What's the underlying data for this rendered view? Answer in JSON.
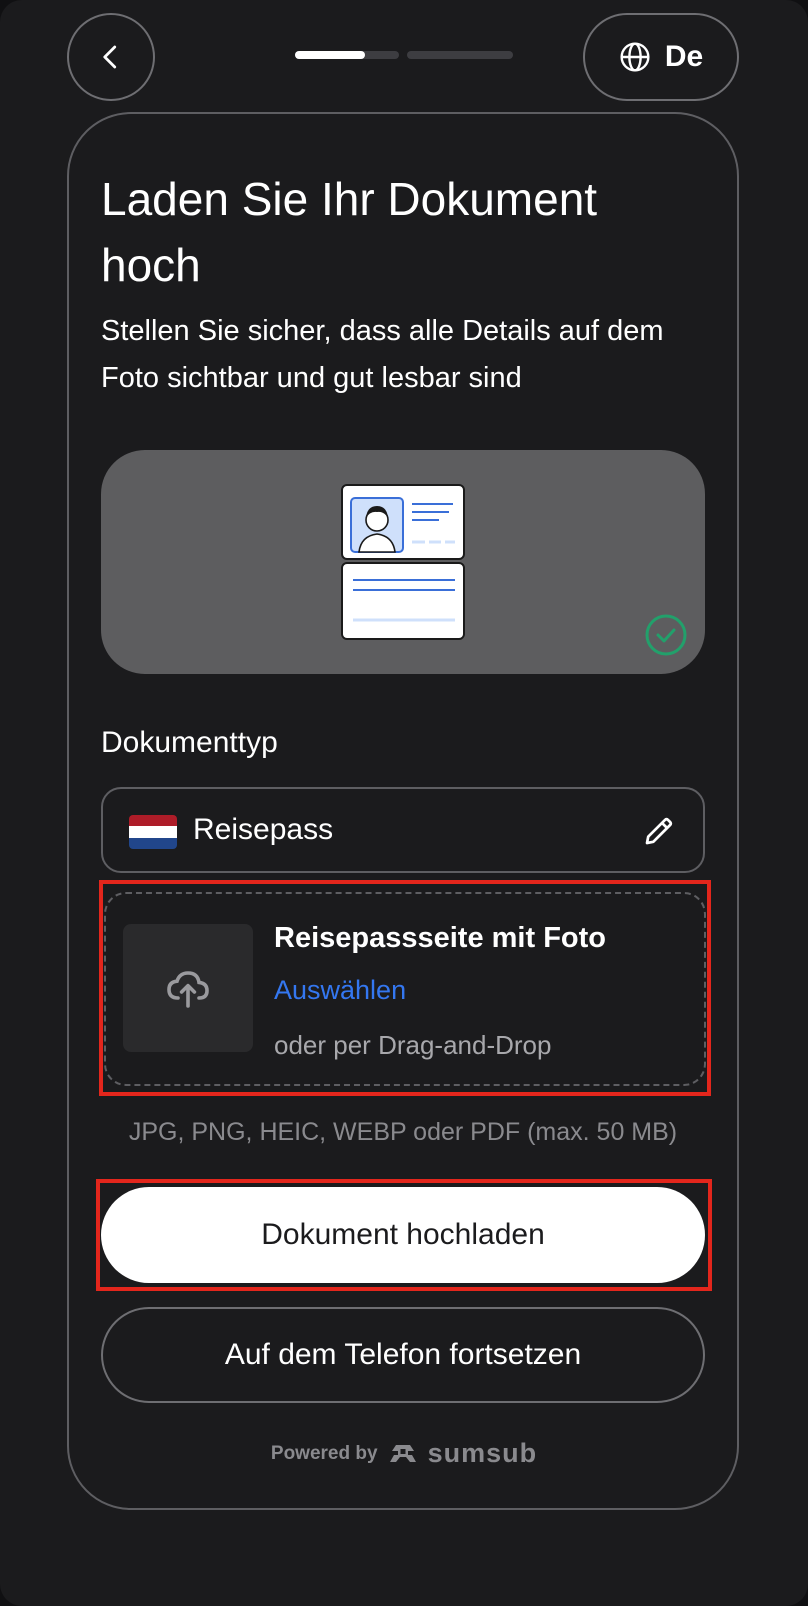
{
  "header": {
    "back_icon": "chevron-left-icon",
    "progress": {
      "steps": 2,
      "current_step": 1,
      "current_step_fraction": 0.67
    },
    "language_icon": "globe-icon",
    "language_label": "De"
  },
  "main": {
    "title": "Laden Sie Ihr Dokument hoch",
    "subtitle": "Stellen Sie sicher, dass alle Details auf dem Foto sichtbar und gut lesbar sind",
    "preview_status_icon": "check-circle-icon",
    "document_type": {
      "label": "Dokumenttyp",
      "value": "Reisepass",
      "flag_colors": [
        "#ae1c28",
        "#ffffff",
        "#21468b"
      ],
      "edit_icon": "pencil-icon"
    },
    "upload": {
      "icon": "cloud-upload-icon",
      "title": "Reisepassseite mit Foto",
      "select_link": "Auswählen",
      "hint": "oder per Drag-and-Drop"
    },
    "formats": "JPG, PNG, HEIC, WEBP oder PDF (max. 50 MB)",
    "primary_button": "Dokument hochladen",
    "secondary_button": "Auf dem Telefon fortsetzen"
  },
  "footer": {
    "powered_by": "Powered by",
    "brand": "sumsub",
    "brand_icon": "sumsub-logo-icon"
  },
  "colors": {
    "background": "#1b1b1d",
    "accent_link": "#3477f0",
    "highlight_red": "#e3261c",
    "success_green": "#22a06b"
  }
}
